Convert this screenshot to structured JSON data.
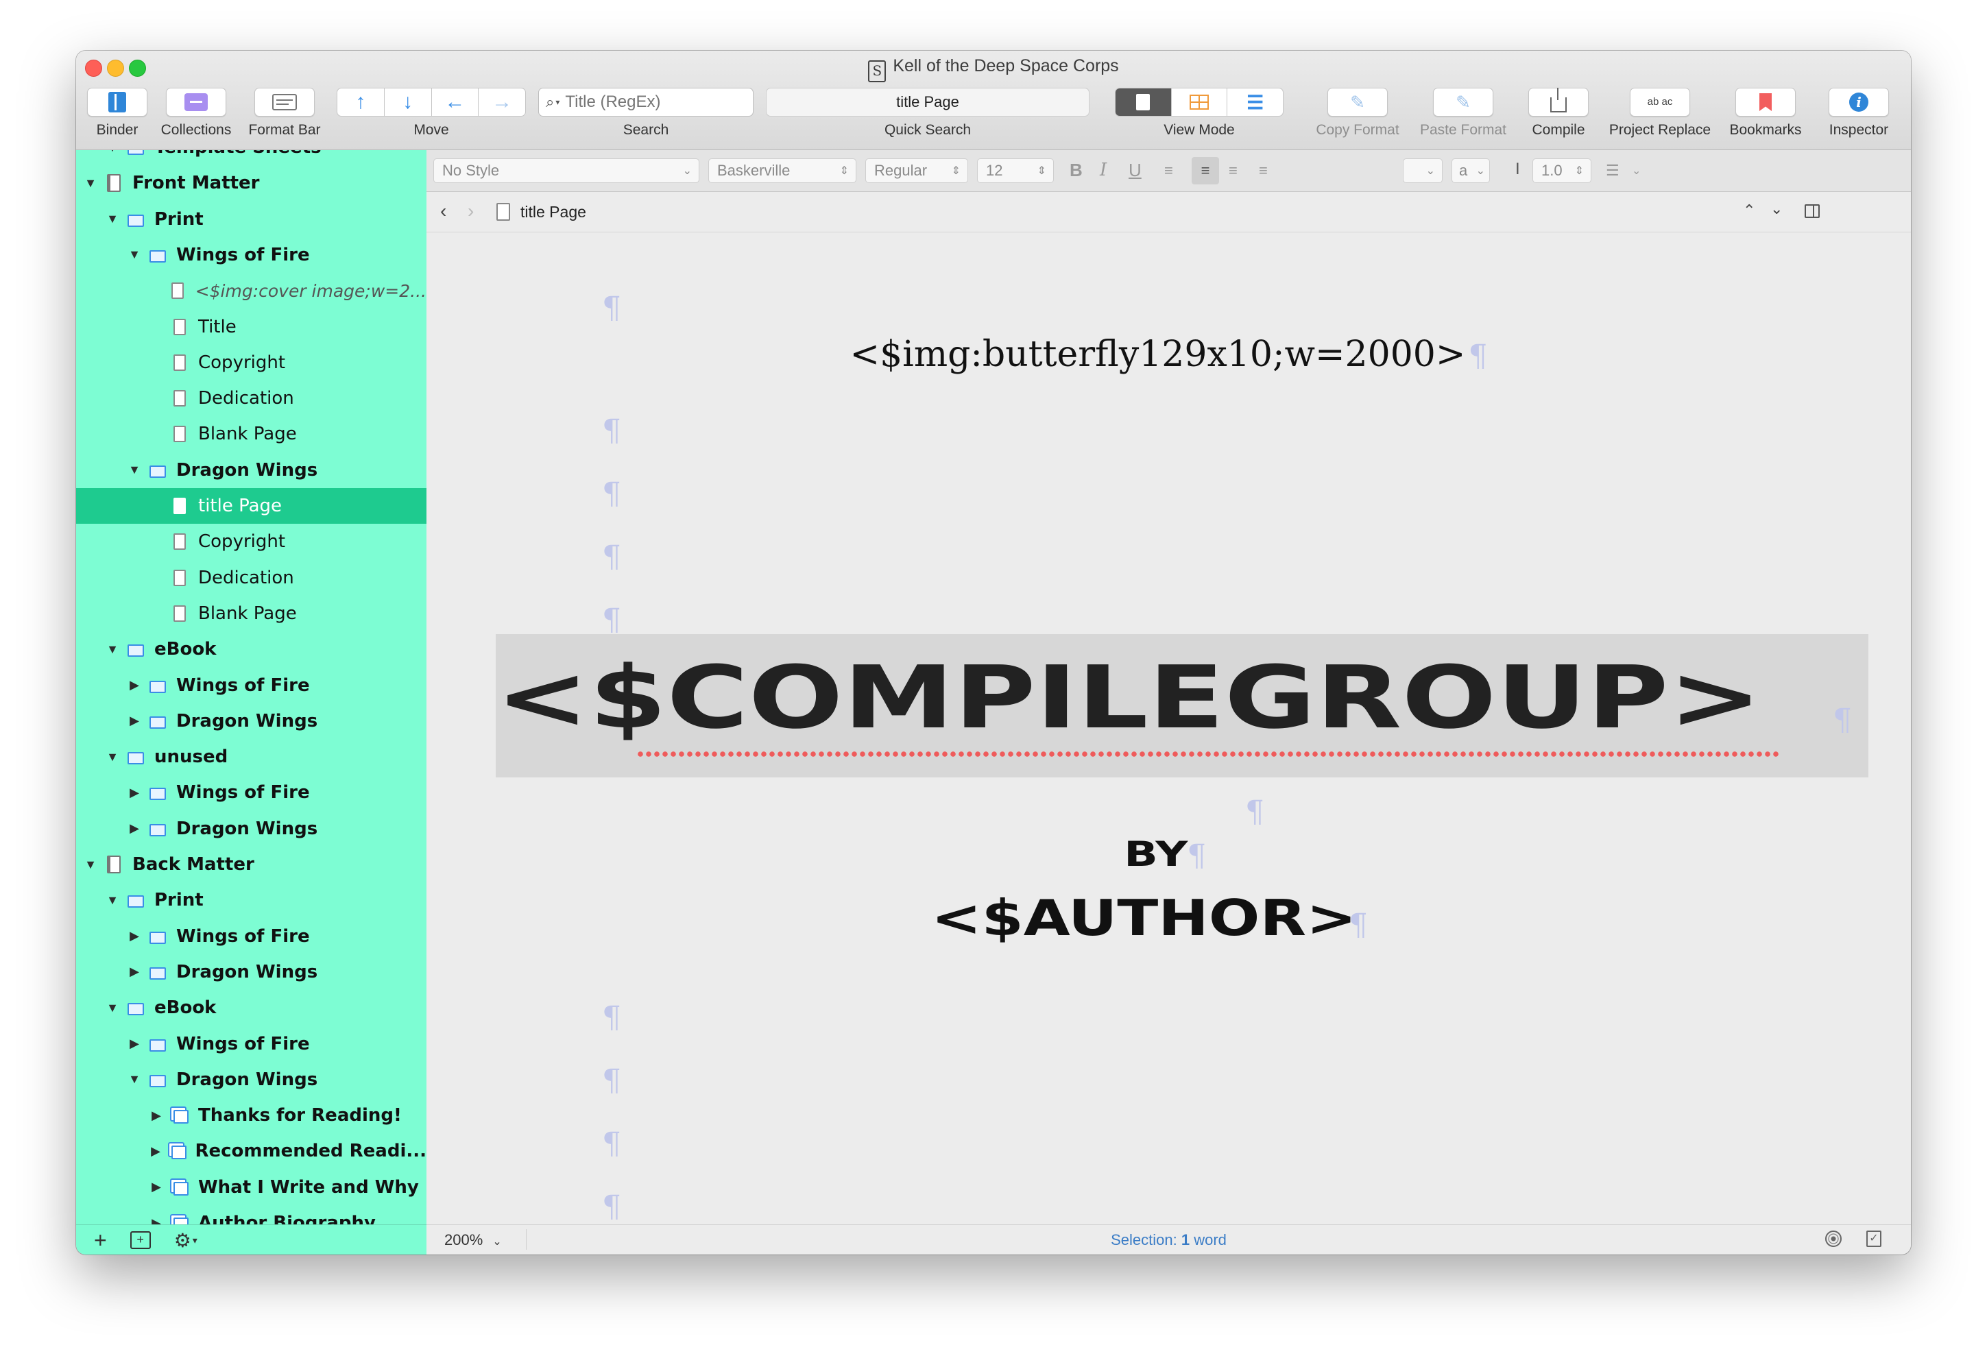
{
  "window": {
    "title": "Kell of the Deep Space Corps"
  },
  "toolbar": {
    "binder": "Binder",
    "collections": "Collections",
    "format_bar": "Format Bar",
    "move": "Move",
    "search_placeholder": "Title (RegEx)",
    "search": "Search",
    "quick_search_value": "title Page",
    "quick_search": "Quick Search",
    "view_mode": "View Mode",
    "copy_format": "Copy Format",
    "paste_format": "Paste Format",
    "compile": "Compile",
    "project_replace": "Project Replace",
    "project_replace_icon_text": "ab ac",
    "bookmarks": "Bookmarks",
    "inspector": "Inspector"
  },
  "binder": {
    "items": [
      {
        "label": "Template Sheets",
        "kind": "folder",
        "bold": true
      },
      {
        "label": "Front Matter",
        "kind": "book",
        "bold": true
      },
      {
        "label": "Print",
        "kind": "folder",
        "bold": true
      },
      {
        "label": "Wings of Fire",
        "kind": "folder",
        "bold": true
      },
      {
        "label": "<$img:cover image;w=2...",
        "kind": "doc",
        "italic": true
      },
      {
        "label": "Title",
        "kind": "doc"
      },
      {
        "label": "Copyright",
        "kind": "doc"
      },
      {
        "label": "Dedication",
        "kind": "doc"
      },
      {
        "label": "Blank Page",
        "kind": "doc"
      },
      {
        "label": "Dragon Wings",
        "kind": "folder",
        "bold": true
      },
      {
        "label": "title Page",
        "kind": "doc",
        "selected": true
      },
      {
        "label": "Copyright",
        "kind": "doc"
      },
      {
        "label": "Dedication",
        "kind": "doc"
      },
      {
        "label": "Blank Page",
        "kind": "doc"
      },
      {
        "label": "eBook",
        "kind": "folder",
        "bold": true
      },
      {
        "label": "Wings of Fire",
        "kind": "folder",
        "bold": true
      },
      {
        "label": "Dragon Wings",
        "kind": "folder",
        "bold": true
      },
      {
        "label": "unused",
        "kind": "folder",
        "bold": true
      },
      {
        "label": "Wings of Fire",
        "kind": "folder",
        "bold": true
      },
      {
        "label": "Dragon Wings",
        "kind": "folder",
        "bold": true
      },
      {
        "label": "Back Matter",
        "kind": "book",
        "bold": true
      },
      {
        "label": "Print",
        "kind": "folder",
        "bold": true
      },
      {
        "label": "Wings of Fire",
        "kind": "folder",
        "bold": true
      },
      {
        "label": "Dragon Wings",
        "kind": "folder",
        "bold": true
      },
      {
        "label": "eBook",
        "kind": "folder",
        "bold": true
      },
      {
        "label": "Wings of Fire",
        "kind": "folder",
        "bold": true
      },
      {
        "label": "Dragon Wings",
        "kind": "folder",
        "bold": true
      },
      {
        "label": "Thanks for Reading!",
        "kind": "stack",
        "bold": true
      },
      {
        "label": "Recommended Readi...",
        "kind": "stack",
        "bold": true
      },
      {
        "label": "What I Write and Why",
        "kind": "stack",
        "bold": true
      },
      {
        "label": "Author Biography",
        "kind": "stack",
        "bold": true
      }
    ]
  },
  "format_bar": {
    "style": "No Style",
    "font": "Baskerville",
    "weight": "Regular",
    "size": "12",
    "bold": "B",
    "italic": "I",
    "underline": "U",
    "text_color": "a",
    "line_spacing": "1.0"
  },
  "header": {
    "doc_title": "title Page"
  },
  "editor": {
    "image_tag": "<$img:butterfly129x10;w=2000>",
    "compile_group": "<$COMPILEGROUP>",
    "by": "BY",
    "author": "<$AUTHOR>",
    "pilcrow": "¶"
  },
  "status": {
    "zoom": "200%",
    "selection_label": "Selection:",
    "selection_count": "1",
    "selection_unit": "word"
  },
  "colors": {
    "binder_bg": "#7dfdd3",
    "binder_selected": "#1ecb8f",
    "accent_blue": "#3a8ee6",
    "bookmark_red": "#f25e5e",
    "collections_purple": "#a88ef0",
    "spell_underline": "#ef5b5b"
  }
}
